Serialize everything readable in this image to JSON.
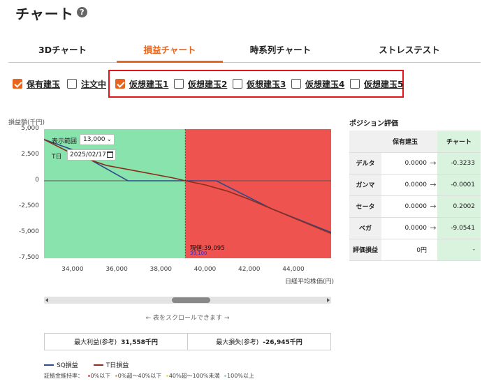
{
  "page": {
    "title": "チャート",
    "help_icon": "question-circle-icon"
  },
  "tabs": [
    {
      "label": "3Dチャート",
      "active": false
    },
    {
      "label": "損益チャート",
      "active": true
    },
    {
      "label": "時系列チャート",
      "active": false
    },
    {
      "label": "ストレステスト",
      "active": false
    }
  ],
  "filters": {
    "holding": {
      "label": "保有建玉",
      "checked": true
    },
    "ordering": {
      "label": "注文中",
      "checked": false
    },
    "virtual": [
      {
        "label": "仮想建玉1",
        "checked": true
      },
      {
        "label": "仮想建玉2",
        "checked": false
      },
      {
        "label": "仮想建玉3",
        "checked": false
      },
      {
        "label": "仮想建玉4",
        "checked": false
      },
      {
        "label": "仮想建玉5",
        "checked": false
      }
    ]
  },
  "chart_controls": {
    "range_label": "表示範囲",
    "range_value": "13,000",
    "date_label": "T日",
    "date_value": "2025/02/17"
  },
  "chart_data": {
    "type": "line",
    "ylabel": "損益額(千円)",
    "xlabel": "日経平均株価(円)",
    "xlim": [
      32700,
      45700
    ],
    "ylim": [
      -7500,
      5000
    ],
    "x_ticks": [
      "34,000",
      "36,000",
      "38,000",
      "40,000",
      "42,000",
      "44,000"
    ],
    "x_tick_values": [
      34000,
      36000,
      38000,
      40000,
      42000,
      44000
    ],
    "y_ticks": [
      "5,000",
      "2,500",
      "0",
      "-2,500",
      "-5,000",
      "-7,500"
    ],
    "y_tick_values": [
      5000,
      2500,
      0,
      -2500,
      -5000,
      -7500
    ],
    "current_price": 39095,
    "current_label": "現値:39,095",
    "current_sub_label": "39,100",
    "zones": [
      {
        "from": 32700,
        "to": 39095,
        "color": "#89e3ac"
      },
      {
        "from": 39095,
        "to": 45700,
        "color": "#ef5350"
      }
    ],
    "series": [
      {
        "name": "SQ損益",
        "color": "#2e4a8a",
        "points": [
          [
            32700,
            4000
          ],
          [
            34000,
            3000
          ],
          [
            36500,
            0
          ],
          [
            40500,
            0
          ],
          [
            43000,
            -2700
          ],
          [
            45700,
            -5000
          ]
        ]
      },
      {
        "name": "T日損益",
        "color": "#8a2e1e",
        "points": [
          [
            32700,
            4000
          ],
          [
            34000,
            2600
          ],
          [
            35500,
            1500
          ],
          [
            37000,
            900
          ],
          [
            38500,
            300
          ],
          [
            39095,
            0
          ],
          [
            40000,
            -400
          ],
          [
            41000,
            -1000
          ],
          [
            42000,
            -1800
          ],
          [
            43000,
            -2700
          ],
          [
            44000,
            -3600
          ],
          [
            45700,
            -5100
          ]
        ]
      }
    ]
  },
  "scroll": {
    "hint": "← 表をスクロールできます →"
  },
  "summary": {
    "max_profit_label": "最大利益(参考)",
    "max_profit_value": "31,558千円",
    "max_loss_label": "最大損失(参考)",
    "max_loss_value": "-26,945千円"
  },
  "legend": {
    "sq": "SQ損益",
    "t": "T日損益",
    "margin_label": "証拠金維持率：",
    "margin_items": [
      {
        "label": "0%以下",
        "color": "#ef5350"
      },
      {
        "label": "0%超〜40%以下",
        "color": "#f2a64e"
      },
      {
        "label": "40%超〜100%未満",
        "color": "#f5d867"
      },
      {
        "label": "100%以上",
        "color": "#89e3ac"
      }
    ]
  },
  "position_eval": {
    "title": "ポジション評価",
    "col_hold": "保有建玉",
    "col_chart": "チャート",
    "rows": [
      {
        "label": "デルタ",
        "hold": "0.0000",
        "chart": "-0.3233"
      },
      {
        "label": "ガンマ",
        "hold": "0.0000",
        "chart": "-0.0001"
      },
      {
        "label": "セータ",
        "hold": "0.0000",
        "chart": "0.2002"
      },
      {
        "label": "ベガ",
        "hold": "0.0000",
        "chart": "-9.0541"
      },
      {
        "label": "評価損益",
        "hold": "0円",
        "chart": "-"
      }
    ]
  }
}
